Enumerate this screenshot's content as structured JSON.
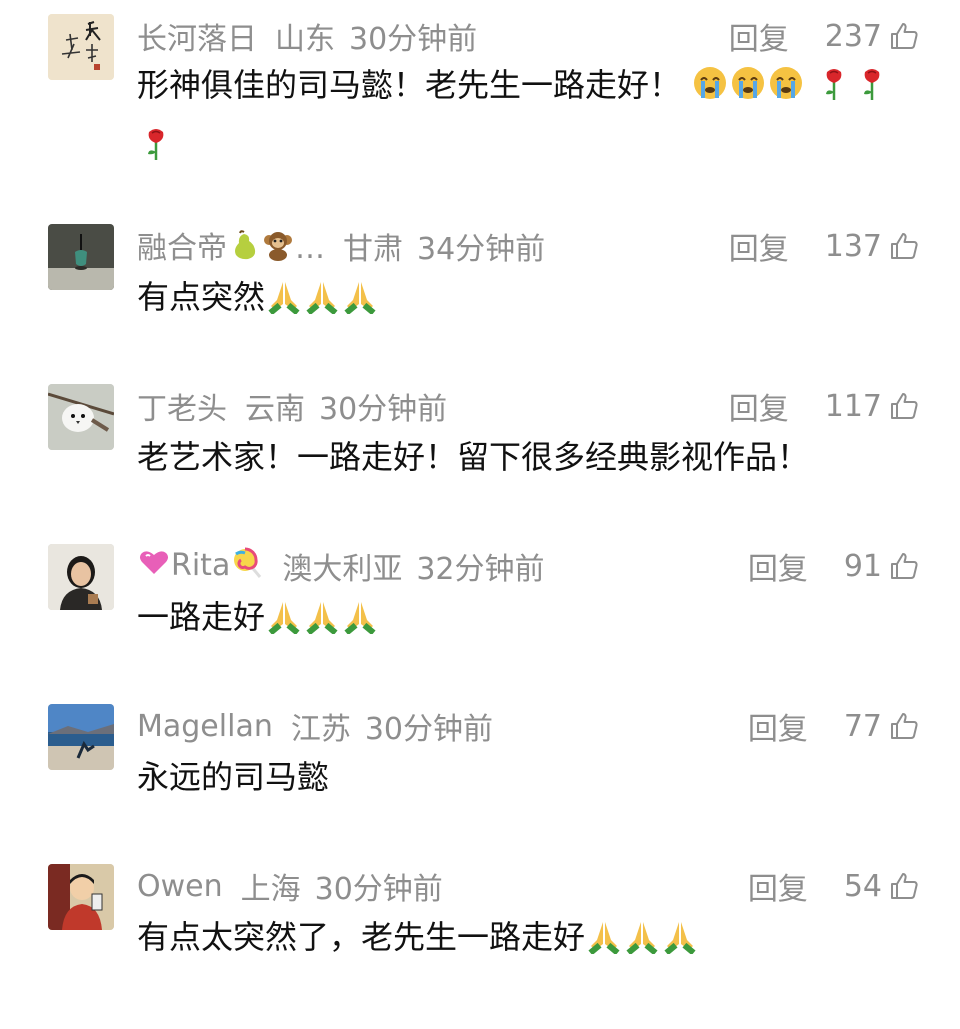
{
  "reply_label": "回复",
  "comments": [
    {
      "name": "长河落日",
      "location": "山东",
      "time": "30分钟前",
      "likes": "237",
      "text": "形神俱佳的司马懿！老先生一路走好！",
      "avatar": "calligraphy-avatar",
      "emojis": [
        "crying-face",
        "crying-face",
        "crying-face",
        "rose",
        "rose",
        "rose"
      ]
    },
    {
      "name": "融合帝",
      "name_suffix": "…",
      "location": "甘肃",
      "time": "34分钟前",
      "likes": "137",
      "text": "有点突然",
      "avatar": "vase-avatar",
      "name_emojis": [
        "pear",
        "monkey"
      ],
      "emojis": [
        "folded-hands",
        "folded-hands",
        "folded-hands"
      ]
    },
    {
      "name": "丁老头",
      "location": "云南",
      "time": "30分钟前",
      "likes": "117",
      "text": "老艺术家！一路走好！留下很多经典影视作品！",
      "avatar": "bird-avatar"
    },
    {
      "name": "Rita",
      "location": "澳大利亚",
      "time": "32分钟前",
      "likes": "91",
      "text": "一路走好",
      "avatar": "woman-avatar",
      "name_emojis": [
        "heart",
        "lollipop"
      ],
      "emojis": [
        "folded-hands",
        "folded-hands",
        "folded-hands"
      ]
    },
    {
      "name": "Magellan",
      "location": "江苏",
      "time": "30分钟前",
      "likes": "77",
      "text": "永远的司马懿",
      "avatar": "lake-avatar"
    },
    {
      "name": "Owen",
      "location": "上海",
      "time": "30分钟前",
      "likes": "54",
      "text": "有点太突然了，老先生一路走好",
      "avatar": "cartoon-avatar",
      "emojis": [
        "folded-hands",
        "folded-hands",
        "folded-hands"
      ]
    }
  ],
  "colors": {
    "meta": "#8e8e8e",
    "text": "#111111",
    "background": "#ffffff"
  }
}
